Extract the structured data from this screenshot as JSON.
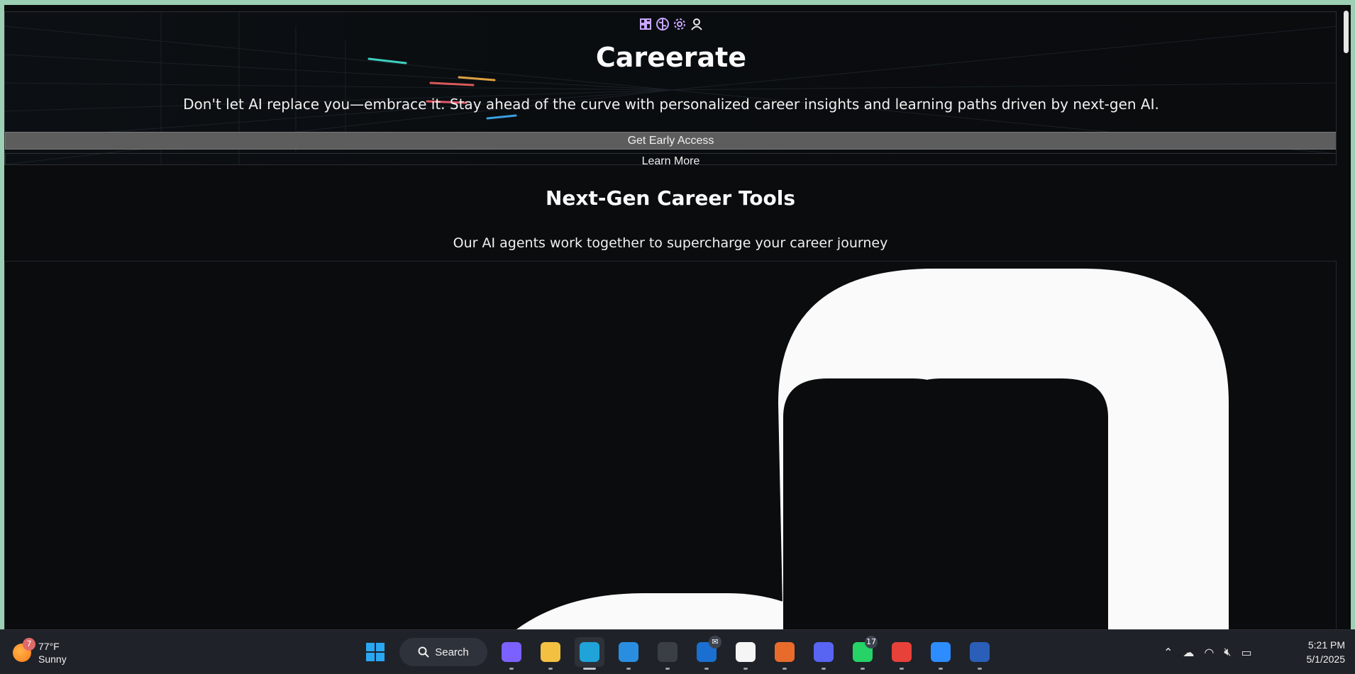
{
  "hero": {
    "icons": [
      "dashboard-icon",
      "brain-icon",
      "gear-icon",
      "user-icon"
    ],
    "title": "Careerate",
    "subtitle": "Don't let AI replace you—embrace it. Stay ahead of the curve with personalized career insights and learning paths driven by next-gen AI.",
    "primary_button": "Get Early Access",
    "secondary_button": "Learn More"
  },
  "section": {
    "title": "Next-Gen Career Tools",
    "subtitle": "Our AI agents work together to supercharge your career journey"
  },
  "taskbar": {
    "weather": {
      "temp": "77°F",
      "condition": "Sunny",
      "badge": "7"
    },
    "search_label": "Search",
    "apps": [
      {
        "name": "copilot-icon",
        "color": "#7b61ff"
      },
      {
        "name": "file-explorer-icon",
        "color": "#f4c042"
      },
      {
        "name": "edge-icon",
        "color": "#1fa3d8",
        "active": true
      },
      {
        "name": "vscode-icon",
        "color": "#2a8ee0"
      },
      {
        "name": "terminal-icon",
        "color": "#3a3f46"
      },
      {
        "name": "outlook-icon",
        "color": "#1a6fd0",
        "badge": "✉"
      },
      {
        "name": "anthropic-icon",
        "color": "#f5f5f5"
      },
      {
        "name": "app-dots-icon",
        "color": "#e86b2c"
      },
      {
        "name": "discord-icon",
        "color": "#5865f2"
      },
      {
        "name": "whatsapp-icon",
        "color": "#25d366",
        "badge": "17"
      },
      {
        "name": "app-red-icon",
        "color": "#e8413a"
      },
      {
        "name": "zoom-icon",
        "color": "#2d8cff"
      },
      {
        "name": "word-icon",
        "color": "#2b5eb8"
      }
    ],
    "clock": {
      "time": "5:21 PM",
      "date": "5/1/2025"
    }
  },
  "colors": {
    "accent": "#c7a6ff",
    "background": "#0a0c0e",
    "frame": "#9ccfb4"
  }
}
